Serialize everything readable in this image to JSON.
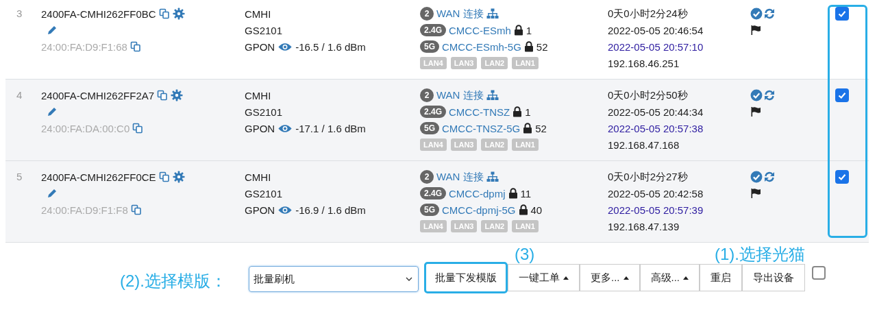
{
  "rows": [
    {
      "index": "3",
      "name": "2400FA-CMHI262FF0BC",
      "mac": "24:00:FA:D9:F1:68",
      "vendor": "CMHI",
      "model": "GS2101",
      "pon": "GPON",
      "optical": "-16.5 / 1.6 dBm",
      "wan_count": "2",
      "wan_label": "WAN 连接",
      "wifi": [
        {
          "band": "2.4G",
          "ssid": "CMCC-ESmh",
          "clients": "1"
        },
        {
          "band": "5G",
          "ssid": "CMCC-ESmh-5G",
          "clients": "52"
        }
      ],
      "lan_ports": [
        "LAN4",
        "LAN3",
        "LAN2",
        "LAN1"
      ],
      "uptime": "0天0小时2分24秒",
      "online_time": "2022-05-05 20:46:54",
      "report_time": "2022-05-05 20:57:10",
      "ip": "192.168.46.251",
      "selected": true
    },
    {
      "index": "4",
      "name": "2400FA-CMHI262FF2A7",
      "mac": "24:00:FA:DA:00:C0",
      "vendor": "CMHI",
      "model": "GS2101",
      "pon": "GPON",
      "optical": "-17.1 / 1.6 dBm",
      "wan_count": "2",
      "wan_label": "WAN 连接",
      "wifi": [
        {
          "band": "2.4G",
          "ssid": "CMCC-TNSZ",
          "clients": "1"
        },
        {
          "band": "5G",
          "ssid": "CMCC-TNSZ-5G",
          "clients": "52"
        }
      ],
      "lan_ports": [
        "LAN4",
        "LAN3",
        "LAN2",
        "LAN1"
      ],
      "uptime": "0天0小时2分50秒",
      "online_time": "2022-05-05 20:44:34",
      "report_time": "2022-05-05 20:57:38",
      "ip": "192.168.47.168",
      "selected": true
    },
    {
      "index": "5",
      "name": "2400FA-CMHI262FF0CE",
      "mac": "24:00:FA:D9:F1:F8",
      "vendor": "CMHI",
      "model": "GS2101",
      "pon": "GPON",
      "optical": "-16.9 / 1.6 dBm",
      "wan_count": "2",
      "wan_label": "WAN 连接",
      "wifi": [
        {
          "band": "2.4G",
          "ssid": "CMCC-dpmj",
          "clients": "11"
        },
        {
          "band": "5G",
          "ssid": "CMCC-dpmj-5G",
          "clients": "40"
        }
      ],
      "lan_ports": [
        "LAN4",
        "LAN3",
        "LAN2",
        "LAN1"
      ],
      "uptime": "0天0小时2分27秒",
      "online_time": "2022-05-05 20:42:58",
      "report_time": "2022-05-05 20:57:39",
      "ip": "192.168.47.139",
      "selected": true
    }
  ],
  "toolbar": {
    "template_label": "(2).选择模版：",
    "template_value": "批量刷机",
    "step3_label": "(3)",
    "step1_label": "(1).选择光猫",
    "buttons": [
      {
        "label": "批量下发模版",
        "kind": "plain",
        "highlighted": true
      },
      {
        "label": "一键工单",
        "kind": "dropup",
        "highlighted": false
      },
      {
        "label": "更多...",
        "kind": "dropup",
        "highlighted": false
      },
      {
        "label": "高级...",
        "kind": "dropup",
        "highlighted": false
      },
      {
        "label": "重启",
        "kind": "plain",
        "highlighted": false
      },
      {
        "label": "导出设备",
        "kind": "plain",
        "highlighted": false
      }
    ],
    "select_all": {
      "checked": false
    }
  }
}
